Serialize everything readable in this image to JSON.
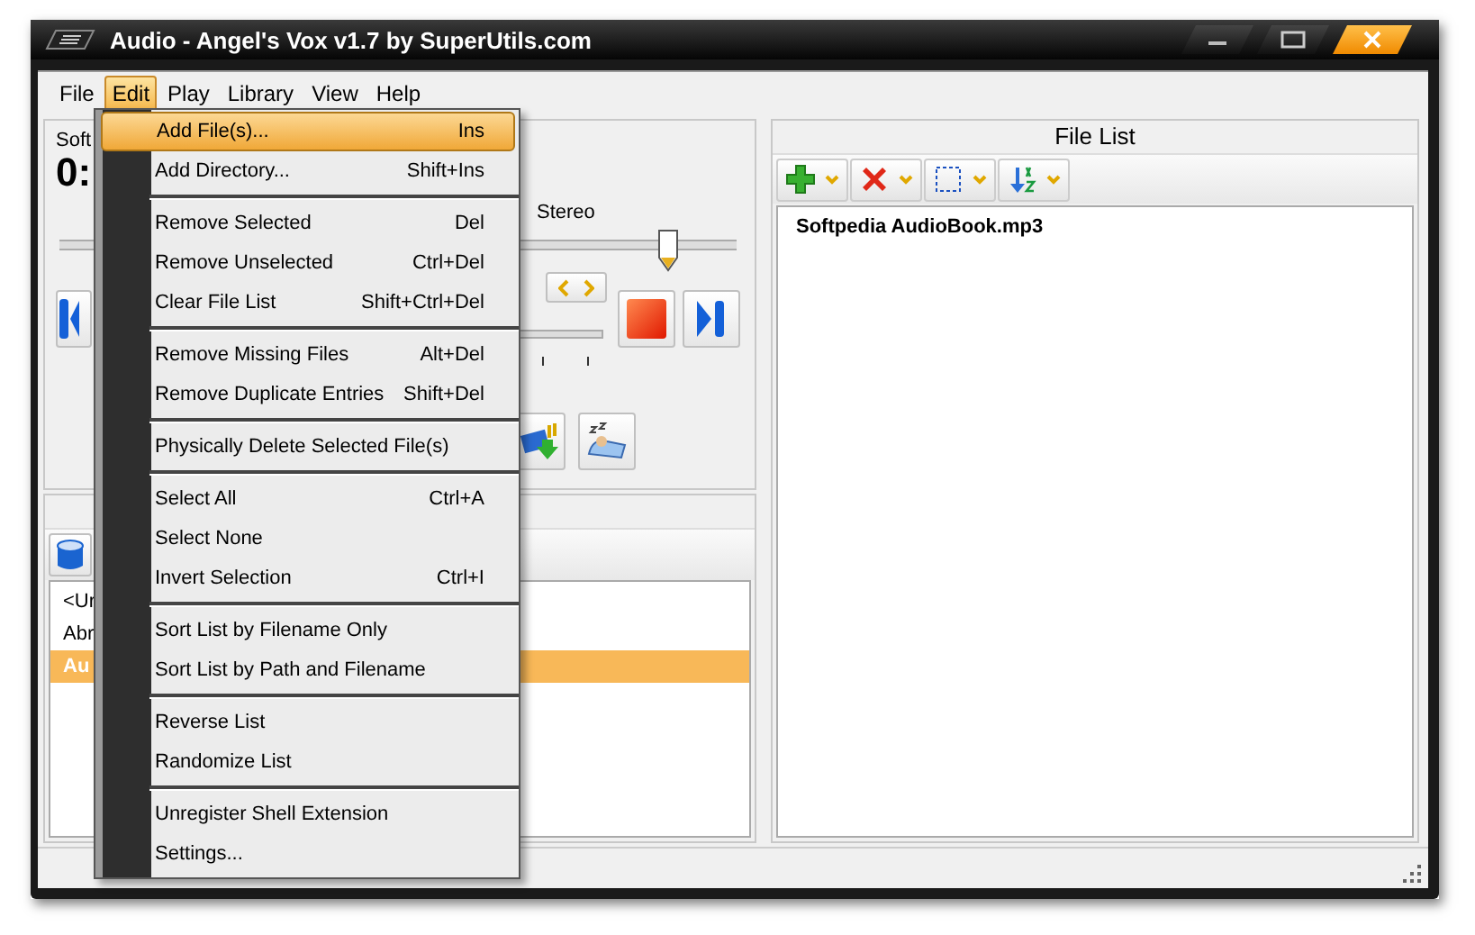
{
  "window": {
    "title": "Audio - Angel's Vox v1.7 by SuperUtils.com"
  },
  "menu_bar": [
    {
      "label": "File",
      "selected": false
    },
    {
      "label": "Edit",
      "selected": true
    },
    {
      "label": "Play",
      "selected": false
    },
    {
      "label": "Library",
      "selected": false
    },
    {
      "label": "View",
      "selected": false
    },
    {
      "label": "Help",
      "selected": false
    }
  ],
  "edit_menu": {
    "groups": [
      [
        {
          "label": "Add File(s)...",
          "shortcut": "Ins",
          "selected": true
        },
        {
          "label": "Add Directory...",
          "shortcut": "Shift+Ins",
          "selected": false
        }
      ],
      [
        {
          "label": "Remove Selected",
          "shortcut": "Del",
          "selected": false
        },
        {
          "label": "Remove Unselected",
          "shortcut": "Ctrl+Del",
          "selected": false
        },
        {
          "label": "Clear File List",
          "shortcut": "Shift+Ctrl+Del",
          "selected": false
        }
      ],
      [
        {
          "label": "Remove Missing Files",
          "shortcut": "Alt+Del",
          "selected": false
        },
        {
          "label": "Remove Duplicate Entries",
          "shortcut": "Shift+Del",
          "selected": false
        }
      ],
      [
        {
          "label": "Physically Delete Selected File(s)",
          "selected": false
        }
      ],
      [
        {
          "label": "Select All",
          "shortcut": "Ctrl+A",
          "selected": false
        },
        {
          "label": "Select None",
          "selected": false
        },
        {
          "label": "Invert Selection",
          "shortcut": "Ctrl+I",
          "selected": false
        }
      ],
      [
        {
          "label": "Sort List by Filename Only",
          "selected": false
        },
        {
          "label": "Sort List by Path and Filename",
          "selected": false
        }
      ],
      [
        {
          "label": "Reverse List",
          "selected": false
        },
        {
          "label": "Randomize List",
          "selected": false
        }
      ],
      [
        {
          "label": "Unregister Shell Extension",
          "selected": false
        },
        {
          "label": "Settings...",
          "selected": false
        }
      ]
    ]
  },
  "player": {
    "track_title": "Soft",
    "time": "0:",
    "channel_mode": "Stereo",
    "position": {
      "level": 0.9
    }
  },
  "library": {
    "items": [
      {
        "label": "<Ur",
        "selected": false
      },
      {
        "label": "Abr",
        "selected": false
      },
      {
        "label": "Au",
        "selected": true
      }
    ]
  },
  "file_list": {
    "title": "File List",
    "files": [
      {
        "name": "Softpedia AudioBook.mp3"
      }
    ]
  }
}
